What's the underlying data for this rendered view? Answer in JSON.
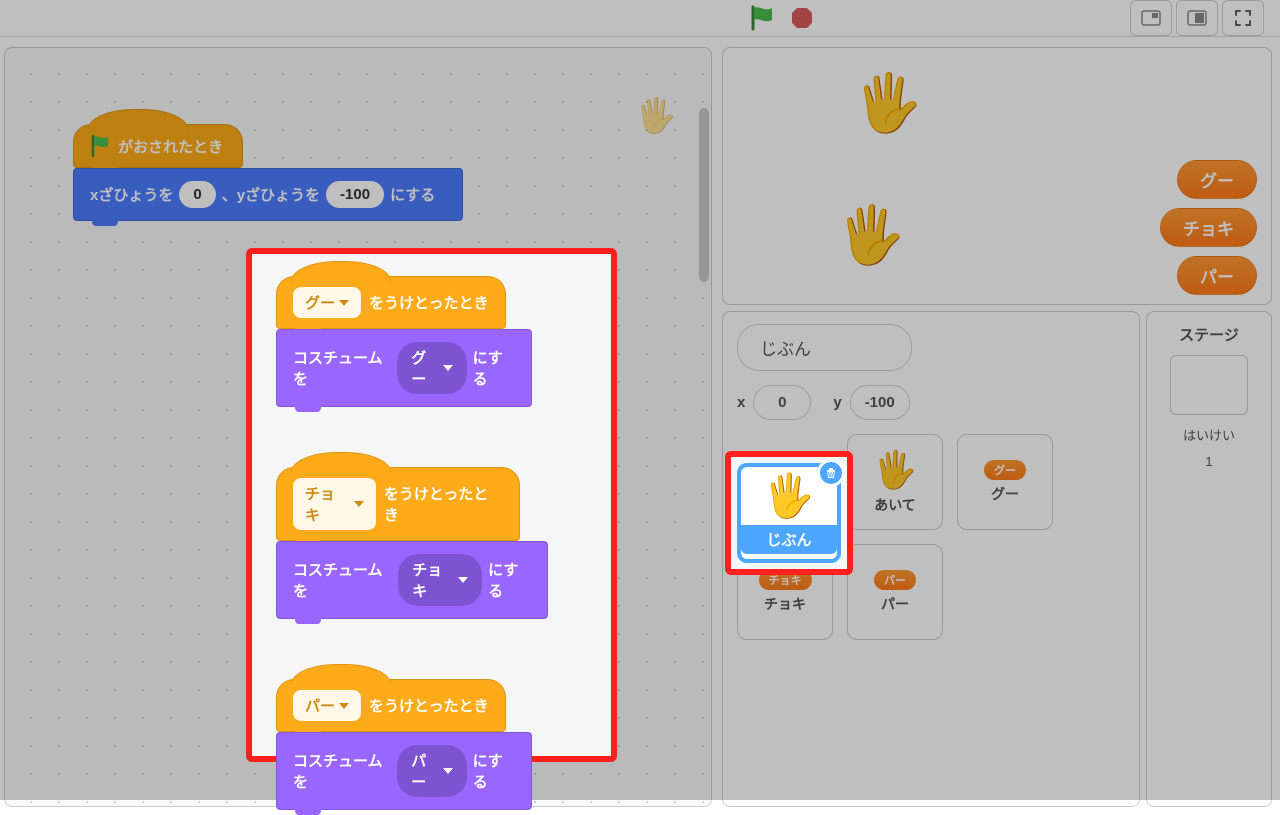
{
  "topbar": {},
  "blocks": {
    "flag_hat": "がおされたとき",
    "goto": {
      "prefix": "xざひょうを",
      "x": "0",
      "mid": "、yざひょうを",
      "y": "-100",
      "suffix": "にする"
    },
    "receive_suffix": "をうけとったとき",
    "switch_prefix": "コスチュームを",
    "switch_suffix": "にする",
    "msg1": "グー",
    "msg2": "チョキ",
    "msg3": "パー"
  },
  "stage_buttons": {
    "rock": "グー",
    "scissors": "チョキ",
    "paper": "パー"
  },
  "sprite_panel": {
    "name": "じぶん",
    "x_label": "x",
    "x_val": "0",
    "y_label": "y",
    "y_val": "-100",
    "tiles": {
      "jibun": "じぶん",
      "aite": "あいて",
      "gu": "グー",
      "choki": "チョキ",
      "pa": "パー"
    }
  },
  "stage_side": {
    "title": "ステージ",
    "backdrop_label": "はいけい",
    "backdrop_count": "1"
  }
}
